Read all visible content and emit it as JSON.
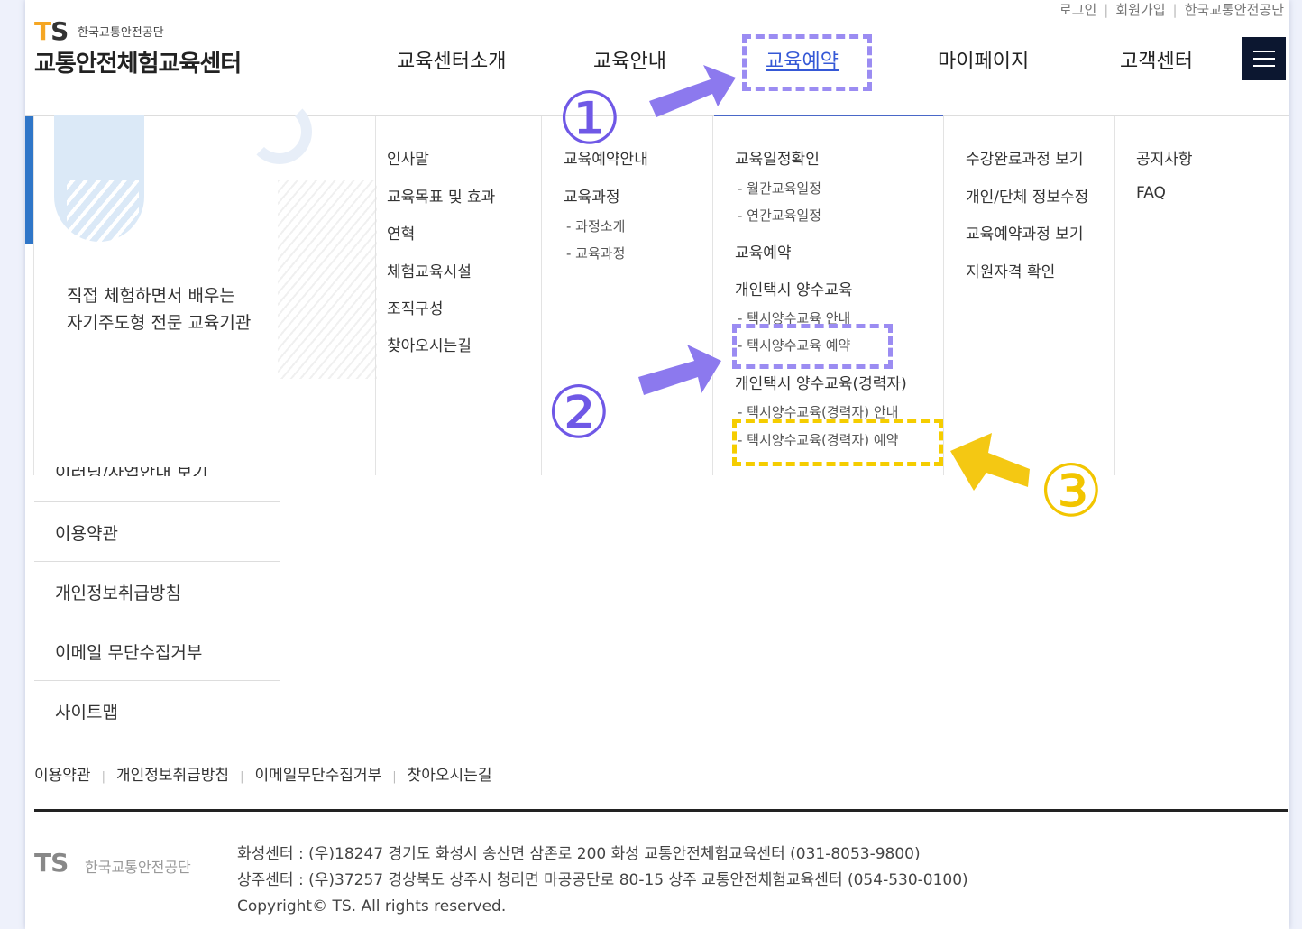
{
  "util": {
    "login": "로그인",
    "join": "회원가입",
    "org": "한국교통안전공단"
  },
  "logo": {
    "ts": "TS",
    "org": "한국교통안전공단",
    "main": "교통안전체험교육센터"
  },
  "gnb": [
    "교육센터소개",
    "교육안내",
    "교육예약",
    "마이페이지",
    "고객센터"
  ],
  "slogan": {
    "line1": "직접 체험하면서 배우는",
    "line2": "자기주도형 전문 교육기관"
  },
  "mega": {
    "col1": [
      "인사말",
      "교육목표 및 효과",
      "연혁",
      "체험교육시설",
      "조직구성",
      "찾아오시는길"
    ],
    "col2": {
      "m1": "교육예약안내",
      "m2": "교육과정",
      "s1": "- 과정소개",
      "s2": "- 교육과정"
    },
    "col3": {
      "m1": "교육일정확인",
      "s1": "- 월간교육일정",
      "s2": "- 연간교육일정",
      "m2": "교육예약",
      "m3": "개인택시 양수교육",
      "s3": "- 택시양수교육 안내",
      "s4": "- 택시양수교육 예약",
      "m4": "개인택시 양수교육(경력자)",
      "s5": "- 택시양수교육(경력자) 안내",
      "s6": "- 택시양수교육(경력자) 예약"
    },
    "col4": [
      "수강완료과정 보기",
      "개인/단체 정보수정",
      "교육예약과정 보기",
      "지원자격 확인"
    ],
    "col5": [
      "공지사항",
      "FAQ"
    ]
  },
  "footer_list": {
    "cut": "이러닝/사업안내 보기",
    "items": [
      "이용약관",
      "개인정보취급방침",
      "이메일 무단수집거부",
      "사이트맵"
    ]
  },
  "footer_links": [
    "이용약관",
    "개인정보취급방침",
    "이메일무단수집거부",
    "찾아오시는길"
  ],
  "footer": {
    "logo": "TS",
    "org": "한국교통안전공단",
    "addr1": "화성센터 : (우)18247 경기도 화성시 송산면 삼존로 200 화성 교통안전체험교육센터 (031-8053-9800)",
    "addr2": "상주센터 : (우)37257 경상북도 상주시 청리면 마공공단로 80-15 상주 교통안전체험교육센터 (054-530-0100)",
    "copyright": "Copyright© TS. All rights reserved."
  },
  "annotations": {
    "n1": "①",
    "n2": "②",
    "n3": "③"
  },
  "colors": {
    "annotation_purple": "#9b8cf2",
    "annotation_yellow": "#f5cd00",
    "active_menu": "#3558d6",
    "menu_button": "#0c1730"
  },
  "icons": {
    "menu": "hamburger-icon"
  }
}
